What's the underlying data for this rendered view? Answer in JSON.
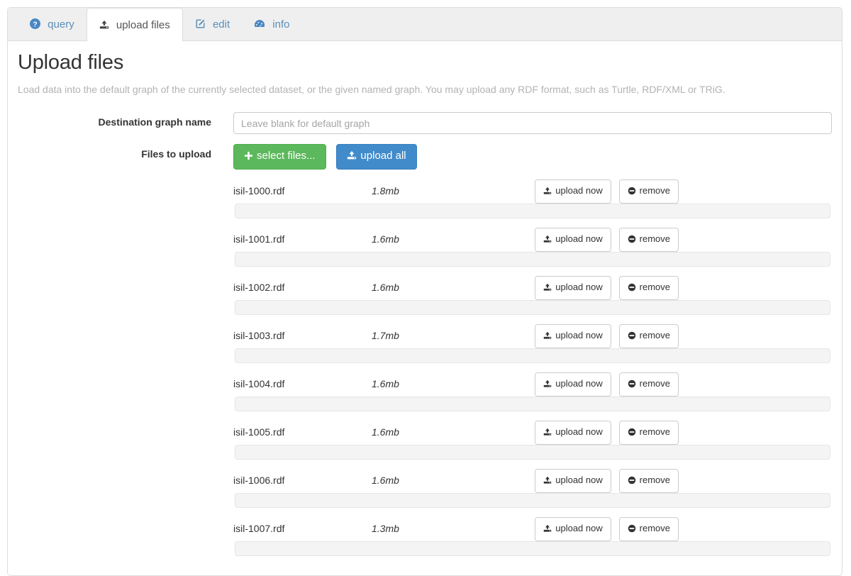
{
  "tabs": [
    {
      "id": "query",
      "label": "query",
      "icon": "question-circle-icon",
      "active": false
    },
    {
      "id": "upload-files",
      "label": "upload files",
      "icon": "upload-icon",
      "active": true
    },
    {
      "id": "edit",
      "label": "edit",
      "icon": "pencil-square-icon",
      "active": false
    },
    {
      "id": "info",
      "label": "info",
      "icon": "dashboard-icon",
      "active": false
    }
  ],
  "page": {
    "title": "Upload files",
    "description": "Load data into the default graph of the currently selected dataset, or the given named graph. You may upload any RDF format, such as Turtle, RDF/XML or TRiG."
  },
  "form": {
    "graph_label": "Destination graph name",
    "graph_value": "",
    "graph_placeholder": "Leave blank for default graph",
    "files_label": "Files to upload",
    "select_files_label": "select files...",
    "upload_all_label": "upload all",
    "select_files_icon": "plus-icon",
    "upload_all_icon": "upload-icon"
  },
  "row_actions": {
    "upload_now_label": "upload now",
    "remove_label": "remove",
    "upload_now_icon": "upload-icon",
    "remove_icon": "minus-circle-icon"
  },
  "files": [
    {
      "name": "isil-1000.rdf",
      "size": "1.8mb",
      "progress": 0
    },
    {
      "name": "isil-1001.rdf",
      "size": "1.6mb",
      "progress": 0
    },
    {
      "name": "isil-1002.rdf",
      "size": "1.6mb",
      "progress": 0
    },
    {
      "name": "isil-1003.rdf",
      "size": "1.7mb",
      "progress": 0
    },
    {
      "name": "isil-1004.rdf",
      "size": "1.6mb",
      "progress": 0
    },
    {
      "name": "isil-1005.rdf",
      "size": "1.6mb",
      "progress": 0
    },
    {
      "name": "isil-1006.rdf",
      "size": "1.6mb",
      "progress": 0
    },
    {
      "name": "isil-1007.rdf",
      "size": "1.3mb",
      "progress": 0
    }
  ],
  "colors": {
    "tab_link": "#5b8fb9",
    "success": "#5cb85c",
    "primary": "#428bca",
    "muted": "#b3b3b3",
    "border": "#dddddd",
    "progress_track": "#f4f4f4"
  }
}
